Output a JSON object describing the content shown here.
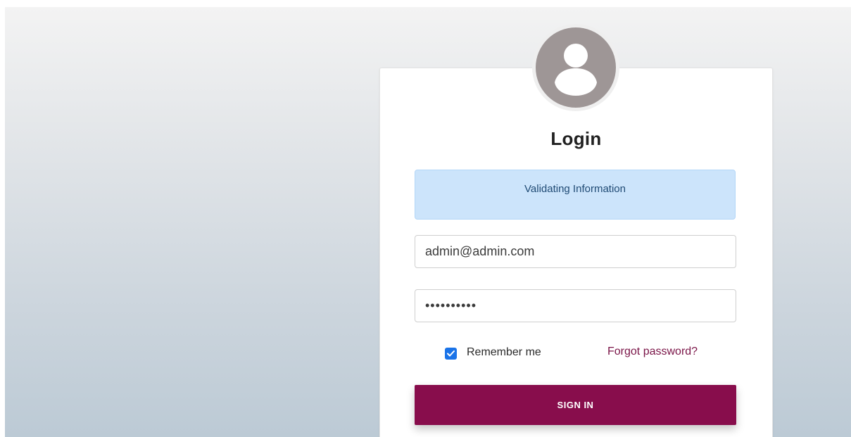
{
  "login": {
    "title": "Login",
    "alert_text": "Validating Information",
    "email_value": "admin@admin.com",
    "password_value": "••••••••••",
    "remember_label": "Remember me",
    "remember_checked": true,
    "forgot_label": "Forgot password?",
    "signin_label": "SIGN IN"
  },
  "icons": {
    "avatar": "user-avatar-icon",
    "check": "check-icon"
  },
  "colors": {
    "primary": "#880d4c",
    "link": "#7a1447",
    "alert_bg": "#cce4fb",
    "alert_text": "#1f4a74",
    "checkbox": "#1a73e8",
    "avatar_fill": "#9e9696"
  }
}
